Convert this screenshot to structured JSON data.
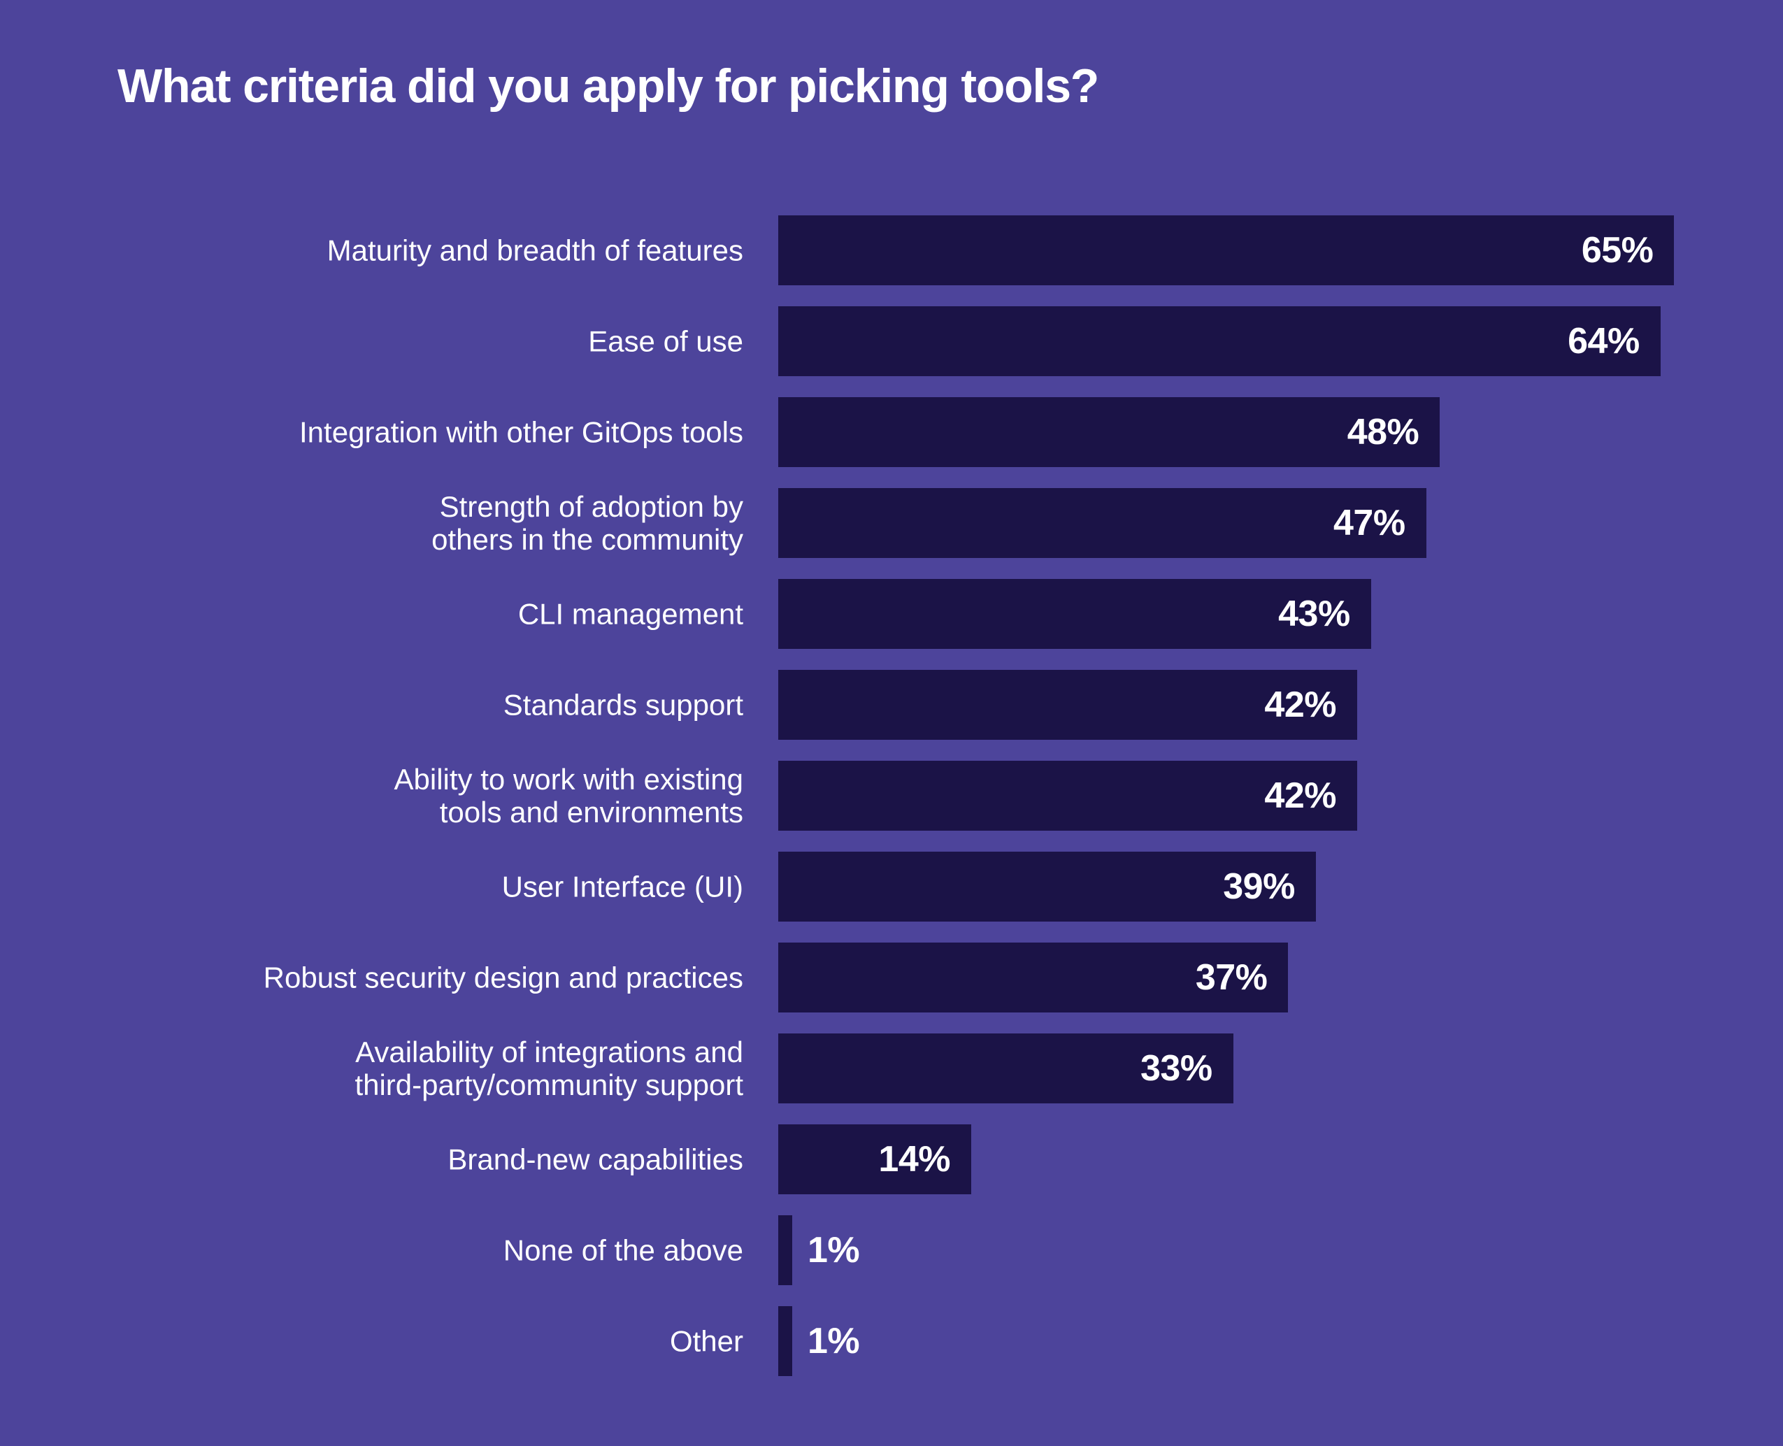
{
  "chart": {
    "title": "What criteria did you apply for picking tools?",
    "background_color": "#4d449b",
    "bar_color": "#1b1347",
    "text_color": "#ffffff"
  },
  "chart_data": {
    "type": "bar",
    "orientation": "horizontal",
    "title": "What criteria did you apply for picking tools?",
    "xlabel": "",
    "ylabel": "",
    "xlim": [
      0,
      70
    ],
    "grid": false,
    "legend": null,
    "value_suffix": "%",
    "categories": [
      "Maturity and breadth of features",
      "Ease of use",
      "Integration with other GitOps tools",
      "Strength of adoption by\nothers in the community",
      "CLI management",
      "Standards support",
      "Ability to work with existing\ntools and environments",
      "User Interface (UI)",
      "Robust security design and practices",
      "Availability of integrations and\nthird-party/community support",
      "Brand-new capabilities",
      "None of the above",
      "Other"
    ],
    "values": [
      65,
      64,
      48,
      47,
      43,
      42,
      42,
      39,
      37,
      33,
      14,
      1,
      1
    ],
    "value_labels": [
      "65%",
      "64%",
      "48%",
      "47%",
      "43%",
      "42%",
      "42%",
      "39%",
      "37%",
      "33%",
      "14%",
      "1%",
      "1%"
    ],
    "label_placement": [
      "inside",
      "inside",
      "inside",
      "inside",
      "inside",
      "inside",
      "inside",
      "inside",
      "inside",
      "inside",
      "inside",
      "outside",
      "outside"
    ]
  }
}
